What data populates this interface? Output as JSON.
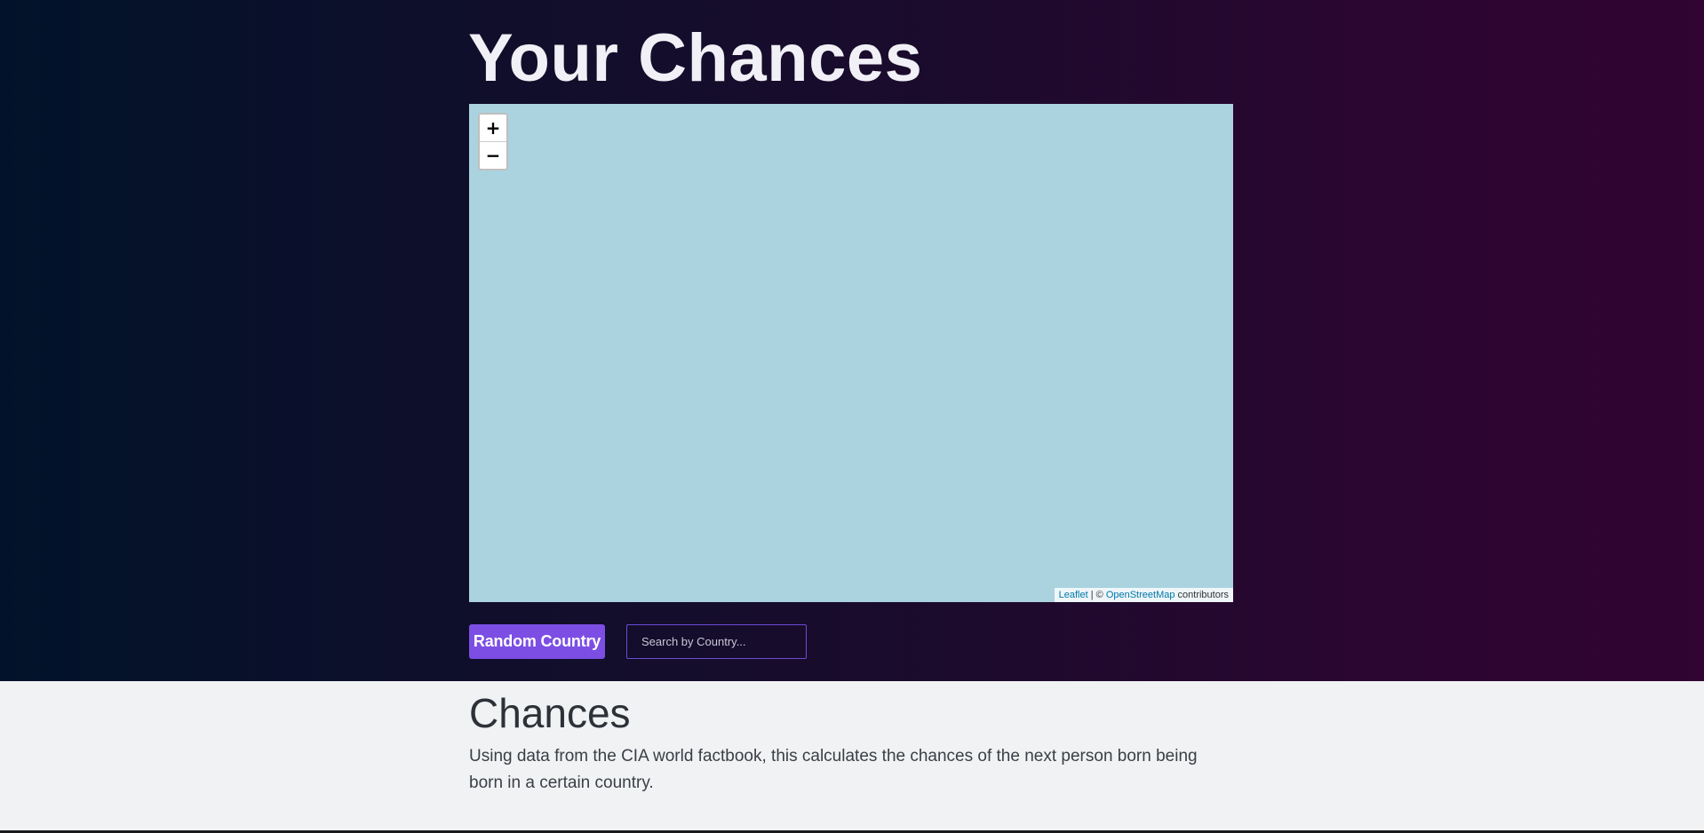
{
  "header": {
    "title": "Your Chances"
  },
  "map": {
    "zoom_in_label": "+",
    "zoom_out_label": "−",
    "attribution": {
      "leaflet_link": "Leaflet",
      "separator": " | © ",
      "osm_link": "OpenStreetMap",
      "suffix": " contributors"
    }
  },
  "controls": {
    "random_button_label": "Random Country",
    "search_placeholder": "Search by Country..."
  },
  "info": {
    "title": "Chances",
    "description": "Using data from the CIA world factbook, this calculates the chances of the next person born being born in a certain country."
  }
}
